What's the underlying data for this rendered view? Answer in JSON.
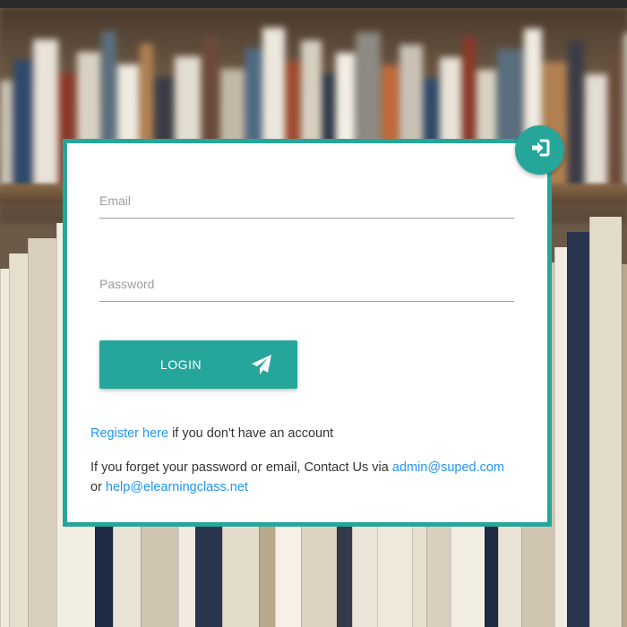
{
  "login_form": {
    "email_placeholder": "Email",
    "password_placeholder": "Password",
    "login_label": "LOGIN",
    "register_link": "Register here",
    "register_suffix": " if you don't have an account",
    "forget_prefix": "If you forget your password or email, Contact Us via ",
    "admin_email": "admin@suped.com",
    "or_text": "or ",
    "help_email": "help@elearningclass.net"
  },
  "icons": {
    "top_button": "sign-in-icon",
    "login_button": "paper-plane-icon"
  },
  "colors": {
    "accent": "#26a69a",
    "link": "#2196f3",
    "text": "#333333",
    "placeholder": "#9e9e9e"
  }
}
